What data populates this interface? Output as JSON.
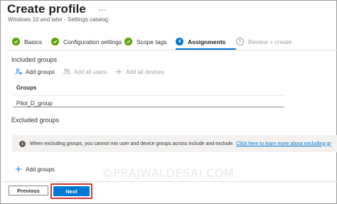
{
  "header": {
    "title": "Create profile",
    "more_icon": "…",
    "subtitle": "Windows 10 and later - Settings catalog"
  },
  "steps": [
    {
      "label": "Basics",
      "state": "done",
      "marker": ""
    },
    {
      "label": "Configuration settings",
      "state": "done",
      "marker": ""
    },
    {
      "label": "Scope tags",
      "state": "done",
      "marker": ""
    },
    {
      "label": "Assignments",
      "state": "current",
      "marker": "4"
    },
    {
      "label": "Review + create",
      "state": "pending",
      "marker": "5"
    }
  ],
  "included": {
    "title": "Included groups",
    "actions": [
      {
        "label": "Add groups",
        "icon": "add-group-icon",
        "enabled": true
      },
      {
        "label": "Add all users",
        "icon": "all-users-icon",
        "enabled": false
      },
      {
        "label": "Add all devices",
        "icon": "add-icon",
        "enabled": false
      }
    ],
    "column_header": "Groups",
    "rows": [
      "Pilot_D_group"
    ]
  },
  "excluded": {
    "title": "Excluded groups",
    "info_text": "When excluding groups, you cannot mix user and device groups across include and exclude.",
    "info_link": "Click here to learn more about excluding gr",
    "add_label": "Add groups"
  },
  "watermark": "©PRAJWALDESAI.COM",
  "footer": {
    "previous": "Previous",
    "next": "Next"
  },
  "colors": {
    "accent": "#0078d4",
    "done": "#57a300",
    "highlight": "#d13438"
  }
}
